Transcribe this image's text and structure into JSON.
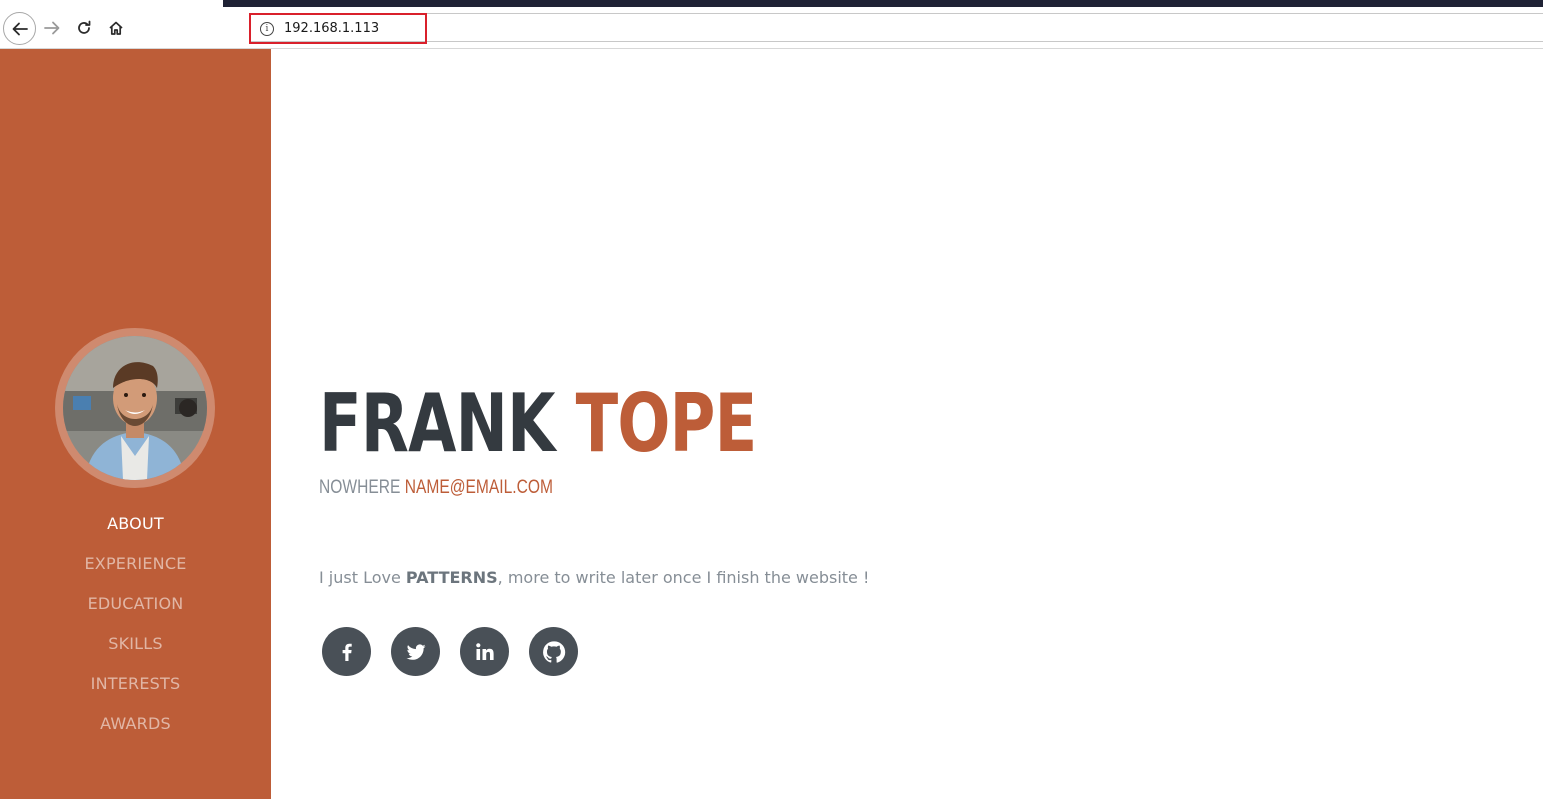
{
  "browser": {
    "url": "192.168.1.113",
    "info_icon": "info-icon",
    "buttons": [
      "back-arrow-icon",
      "forward-arrow-icon",
      "reload-icon",
      "home-icon"
    ]
  },
  "sidebar": {
    "background_color": "#bd5d38",
    "profile_image": "profile-photo",
    "menu": [
      {
        "label": "ABOUT",
        "active": true
      },
      {
        "label": "EXPERIENCE",
        "active": false
      },
      {
        "label": "EDUCATION",
        "active": false
      },
      {
        "label": "SKILLS",
        "active": false
      },
      {
        "label": "INTERESTS",
        "active": false
      },
      {
        "label": "AWARDS",
        "active": false
      }
    ]
  },
  "about": {
    "first_name": "FRANK",
    "last_name": "TOPE",
    "location": "NOWHERE",
    "email": "NAME@EMAIL.COM",
    "intro_before": "I just Love ",
    "intro_bold": "PATTERNS",
    "intro_after": ", more to write later once I finish the website !",
    "social_icons": [
      "facebook-icon",
      "twitter-icon",
      "linkedin-icon",
      "github-icon"
    ]
  },
  "colors": {
    "accent": "#bd5d38",
    "heading": "#343a40",
    "muted": "#868e96",
    "social_bg": "#495057"
  }
}
